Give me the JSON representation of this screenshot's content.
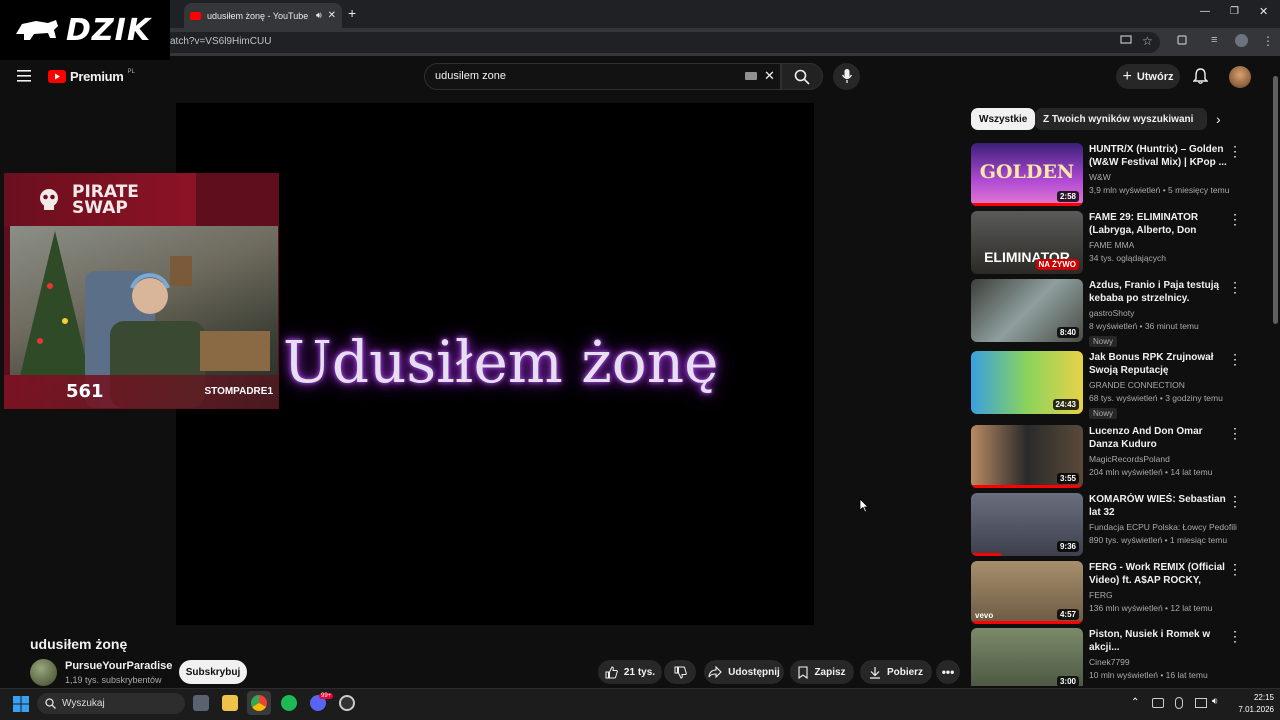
{
  "browser": {
    "tab_title": "udusiłem żonę - YouTube",
    "url_visible": "atch?v=VS6l9HimCUU"
  },
  "overlay_brand": {
    "logo_text": "DZIK"
  },
  "youtube": {
    "logo_text": "Premium",
    "logo_region": "PL",
    "search_query": "udusilem zone",
    "create_label": "Utwórz"
  },
  "player": {
    "display_text": "Udusiłem żonę"
  },
  "stream_overlay": {
    "sponsor_line1": "PIRATE",
    "sponsor_line2": "SWAP",
    "badge_number": "561",
    "tiktok_handle": "STOMPADRE1"
  },
  "video": {
    "title": "udusiłem żonę",
    "channel_name": "PursueYourParadise",
    "channel_subs": "1,19 tys. subskrybentów",
    "subscribe_label": "Subskrybuj",
    "like_count": "21 tys.",
    "share_label": "Udostępnij",
    "save_label": "Zapisz",
    "download_label": "Pobierz"
  },
  "chips": [
    "Wszystkie",
    "Z Twoich wyników wyszukiwania"
  ],
  "sidebar": [
    {
      "title": "HUNTR/X (Huntrix) – Golden (W&W Festival Mix) | KPop ...",
      "channel": "W&W",
      "stats": "3,9 mln wyświetleń • 5 miesięcy temu",
      "duration": "2:58",
      "thumb_text": "GOLDEN"
    },
    {
      "title": "FAME 29: ELIMINATOR (Labryga, Alberto, Don Diego, ...",
      "channel": "FAME MMA",
      "stats": "34 tys. oglądających",
      "live_label": "NA ŻYWO",
      "thumb_text": "ELIMINATOR"
    },
    {
      "title": "Azdus, Franio i Paja testują kebaba po strzelnicy.",
      "channel": "gastroShoty",
      "stats": "8 wyświetleń • 36 minut temu",
      "duration": "8:40",
      "badge": "Nowy"
    },
    {
      "title": "Jak Bonus RPK Zrujnował Swoją Reputację",
      "channel": "GRANDE CONNECTION",
      "stats": "68 tys. wyświetleń • 3 godziny temu",
      "duration": "24:43",
      "badge": "Nowy"
    },
    {
      "title": "Lucenzo And Don Omar Danza Kuduro",
      "channel": "MagicRecordsPoland",
      "stats": "204 mln wyświetleń • 14 lat temu",
      "duration": "3:55"
    },
    {
      "title": "KOMARÓW WIEŚ: Sebastian lat 32",
      "channel": "Fundacja ECPU Polska: Łowcy Pedofili",
      "stats": "890 tys. wyświetleń • 1 miesiąc temu",
      "duration": "9:36"
    },
    {
      "title": "FERG - Work REMIX (Official Video) ft. A$AP ROCKY, Frenc...",
      "channel": "FERG",
      "stats": "136 mln wyświetleń • 12 lat temu",
      "duration": "4:57",
      "thumb_text": "vevo"
    },
    {
      "title": "Piston, Nusiek i Romek w akcji...",
      "channel": "Cinek7799",
      "stats": "10 mln wyświetleń • 16 lat temu",
      "duration": "3:00"
    }
  ],
  "taskbar": {
    "search_label": "Wyszukaj",
    "time": "22:15",
    "date": "7.01.2026",
    "discord_badge": "99+"
  }
}
